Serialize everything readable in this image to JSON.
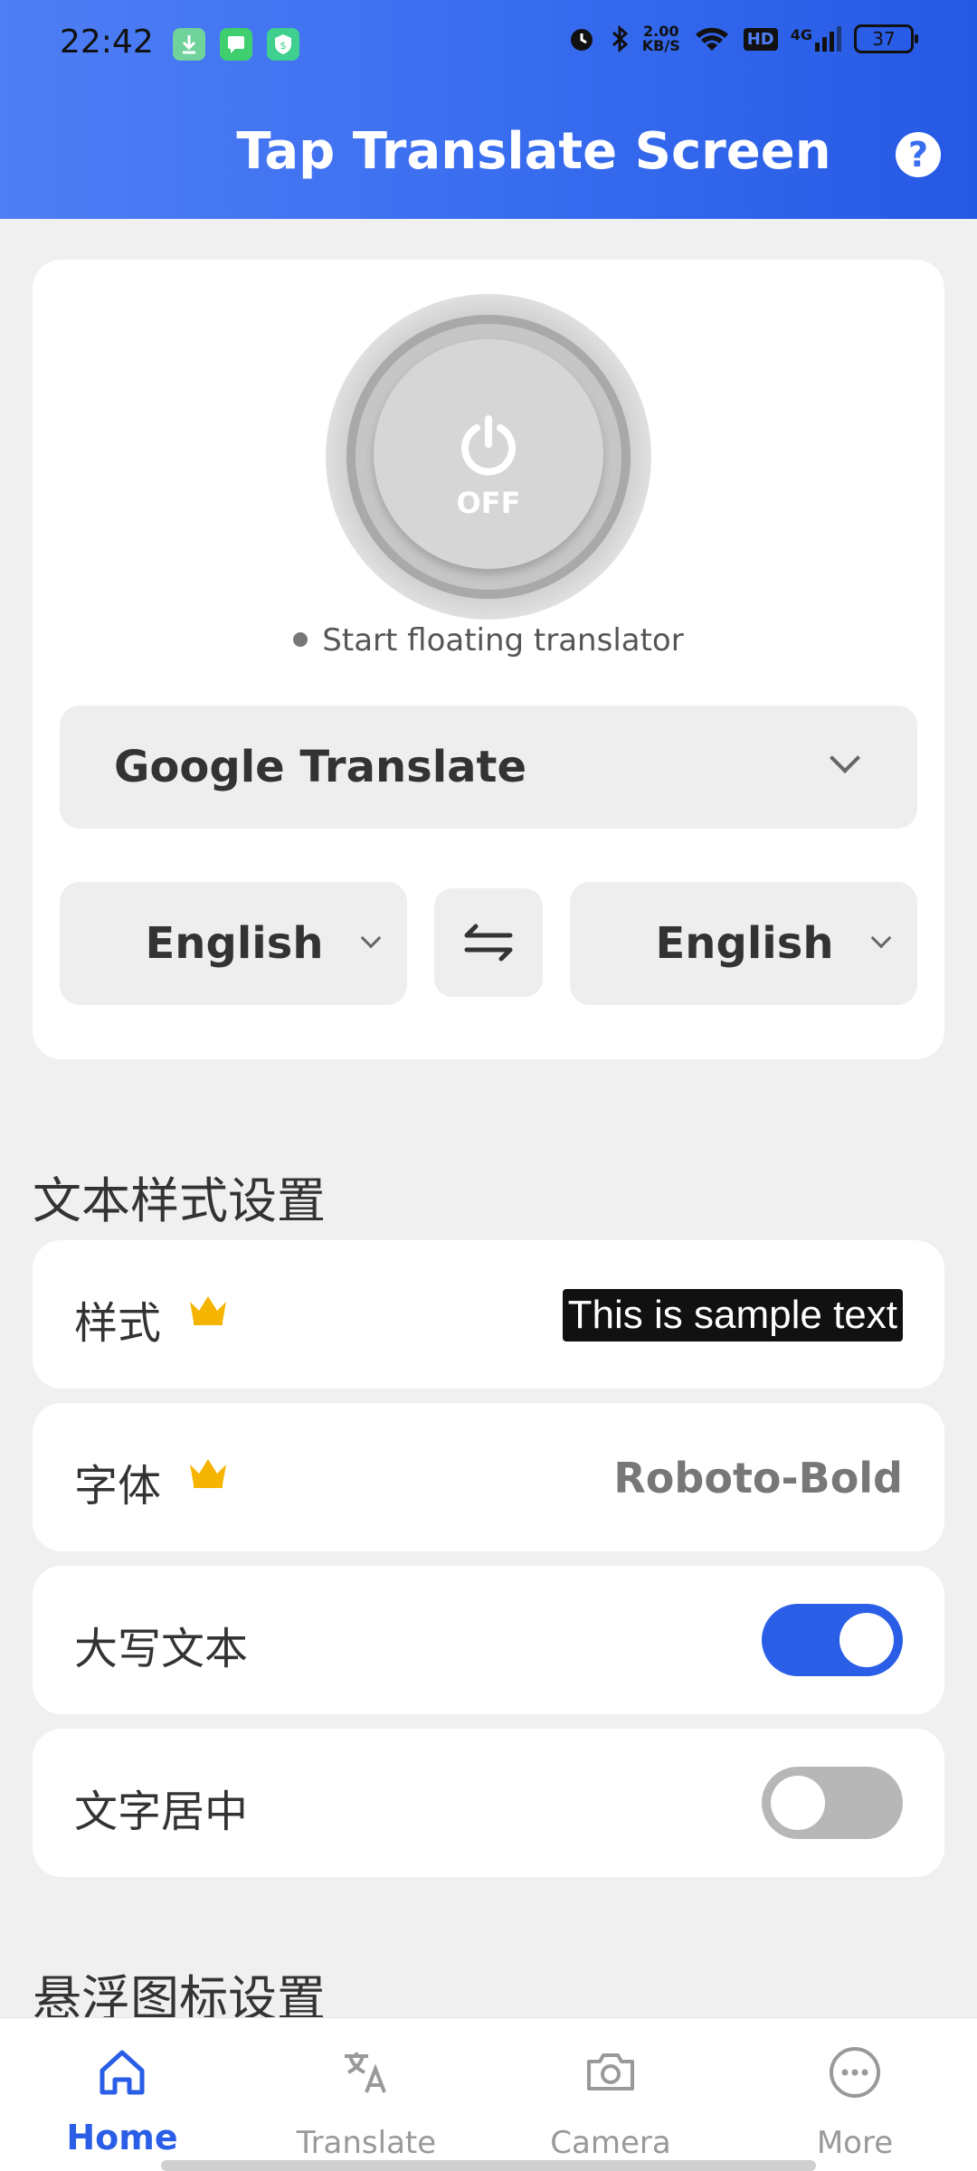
{
  "status_bar": {
    "time": "22:42",
    "net_speed_value": "2.00",
    "net_speed_unit": "KB/S",
    "hd_label": "HD",
    "signal_label": "4G",
    "battery": "37"
  },
  "header": {
    "title": "Tap Translate Screen",
    "help_label": "?"
  },
  "power": {
    "state_label": "OFF",
    "hint": "Start floating translator"
  },
  "engine": {
    "selected": "Google Translate"
  },
  "languages": {
    "source": "English",
    "target": "English"
  },
  "text_style_section": {
    "title": "文本样式设置",
    "style_label": "样式",
    "sample_text": "This is sample text",
    "font_label": "字体",
    "font_value": "Roboto-Bold",
    "uppercase_label": "大写文本",
    "uppercase_on": true,
    "center_label": "文字居中",
    "center_on": false
  },
  "float_icon_section": {
    "title": "悬浮图标设置"
  },
  "bottom_nav": {
    "items": [
      {
        "label": "Home",
        "icon": "home-icon",
        "active": true
      },
      {
        "label": "Translate",
        "icon": "translate-icon",
        "active": false
      },
      {
        "label": "Camera",
        "icon": "camera-icon",
        "active": false
      },
      {
        "label": "More",
        "icon": "more-icon",
        "active": false
      }
    ]
  },
  "colors": {
    "accent": "#2a5ee6",
    "premium_crown": "#f5b400"
  }
}
